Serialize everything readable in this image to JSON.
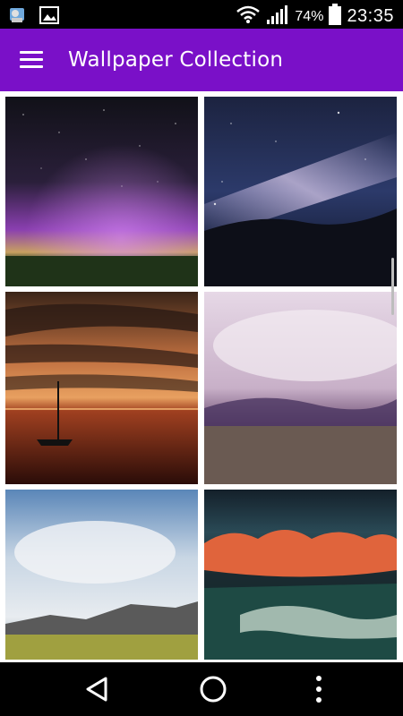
{
  "status_bar": {
    "battery_percent": "74%",
    "time": "23:35",
    "icons": [
      "notification-icon",
      "image-icon",
      "wifi-icon",
      "signal-icon",
      "battery-icon"
    ]
  },
  "app_bar": {
    "title": "Wallpaper Collection",
    "menu_icon": "hamburger-menu-icon",
    "background": "#7a10c8"
  },
  "wallpapers": [
    {
      "name": "aurora-night-sky"
    },
    {
      "name": "milky-way-over-hills"
    },
    {
      "name": "sunset-sailboat"
    },
    {
      "name": "purple-storm-clouds"
    },
    {
      "name": "cloudy-mountain-valley"
    },
    {
      "name": "red-clouds-ocean-wave"
    }
  ],
  "nav_bar": {
    "back": "back-icon",
    "home": "home-icon",
    "menu": "more-vertical-icon"
  }
}
